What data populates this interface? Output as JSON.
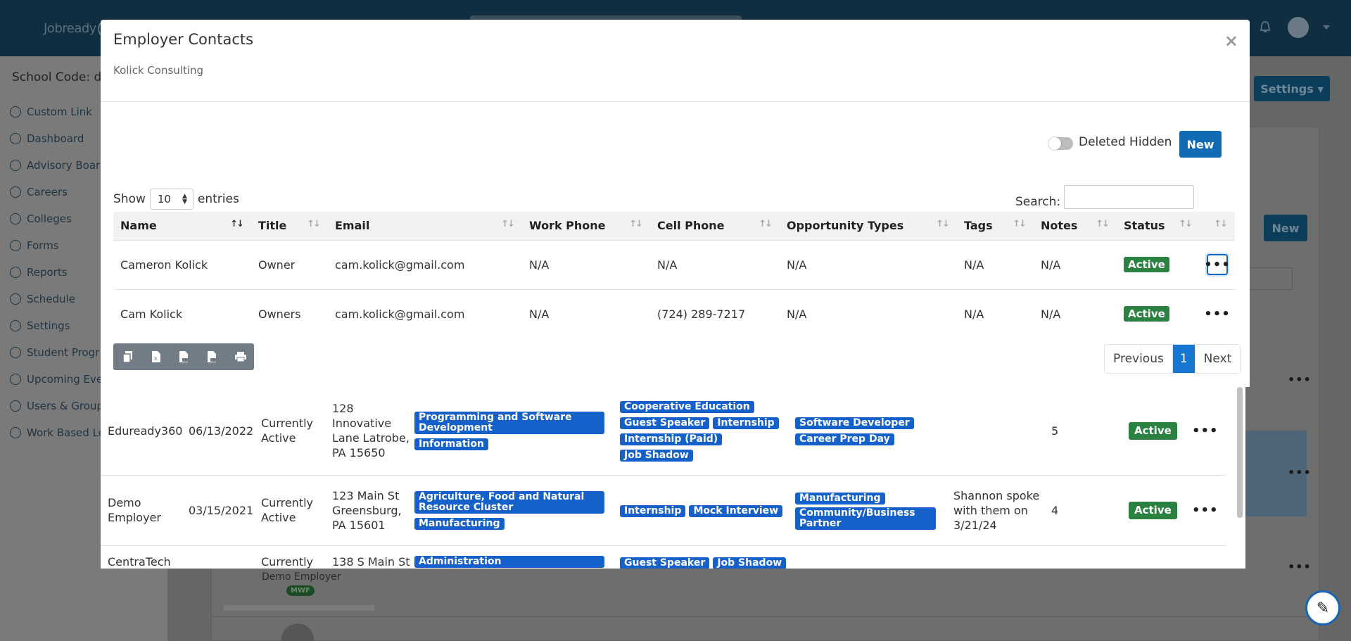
{
  "app": {
    "logo_text": "Jobready",
    "school_code": "School Code: de",
    "settings_button": "Settings",
    "new_button": "New",
    "bg_demo_employer": "Demo Employer",
    "bg_mwf_badge": "MWF"
  },
  "sidebar": {
    "items": [
      {
        "label": "Custom Link",
        "icon": "globe-icon"
      },
      {
        "label": "Dashboard",
        "icon": "dashboard-icon"
      },
      {
        "label": "Advisory Boar",
        "icon": "advisory-icon"
      },
      {
        "label": "Careers",
        "icon": "user-icon"
      },
      {
        "label": "Colleges",
        "icon": "college-icon"
      },
      {
        "label": "Forms",
        "icon": "document-icon"
      },
      {
        "label": "Reports",
        "icon": "print-icon"
      },
      {
        "label": "Schedule",
        "icon": "clock-icon"
      },
      {
        "label": "Settings",
        "icon": "settings-icon"
      },
      {
        "label": "Student Progr",
        "icon": "progress-icon"
      },
      {
        "label": "Upcoming Eve",
        "icon": "bell-icon"
      },
      {
        "label": "Users & Group",
        "icon": "users-icon"
      },
      {
        "label": "Work Based Le",
        "icon": "badge-icon"
      }
    ]
  },
  "modal": {
    "title": "Employer Contacts",
    "subtitle": "Kolick Consulting",
    "close": "×",
    "toggle_label": "Deleted Hidden",
    "new_button": "New",
    "show_label": "Show",
    "entries_value": "10",
    "entries_label": "entries",
    "search_label": "Search:",
    "search_value": "",
    "columns": [
      "Name",
      "Title",
      "Email",
      "Work Phone",
      "Cell Phone",
      "Opportunity Types",
      "Tags",
      "Notes",
      "Status",
      ""
    ],
    "rows": [
      {
        "name": "Cameron Kolick",
        "title": "Owner",
        "email": "cam.kolick@gmail.com",
        "work_phone": "N/A",
        "cell_phone": "N/A",
        "opportunity_types": "N/A",
        "tags": "N/A",
        "notes": "N/A",
        "status": "Active",
        "actions": "•••"
      },
      {
        "name": "Cam Kolick",
        "title": "Owners",
        "email": "cam.kolick@gmail.com",
        "work_phone": "N/A",
        "cell_phone": "(724) 289-7217",
        "opportunity_types": "N/A",
        "tags": "N/A",
        "notes": "N/A",
        "status": "Active",
        "actions": "•••"
      }
    ],
    "pagination": {
      "previous": "Previous",
      "current": "1",
      "next": "Next"
    }
  },
  "employers": [
    {
      "name": "Eduready360",
      "date": "06/13/2022",
      "state": "Currently Active",
      "address": "128 Innovative Lane Latrobe, PA 15650",
      "clusters": [
        "Programming and Software Development",
        "Information"
      ],
      "opportunities": [
        "Cooperative Education",
        "Guest Speaker",
        "Internship",
        "Internship (Paid)",
        "Job Shadow"
      ],
      "careers": [
        "Software Developer",
        "Career Prep Day"
      ],
      "notes": "",
      "count": "5",
      "status": "Active",
      "actions": "•••"
    },
    {
      "name": "Demo Employer",
      "date": "03/15/2021",
      "state": "Currently Active",
      "address": "123 Main St Greensburg, PA 15601",
      "clusters": [
        "Agriculture, Food and Natural Resource Cluster",
        "Manufacturing"
      ],
      "opportunities": [
        "Internship",
        "Mock Interview"
      ],
      "careers": [
        "Manufacturing",
        "Community/Business Partner"
      ],
      "notes": "Shannon spoke with them on 3/21/24",
      "count": "4",
      "status": "Active",
      "actions": "•••"
    },
    {
      "name": "CentraTech",
      "date": "",
      "state": "Currently",
      "address": "138 S Main St",
      "clusters": [
        "Administration"
      ],
      "opportunities": [
        "Guest Speaker",
        "Job Shadow"
      ],
      "careers": [],
      "notes": "",
      "count": "",
      "status": "",
      "actions": ""
    }
  ],
  "colors": {
    "primary": "#116ab4",
    "active": "#2a8140",
    "tag": "#1661c9",
    "topbar": "#0f2e40"
  }
}
